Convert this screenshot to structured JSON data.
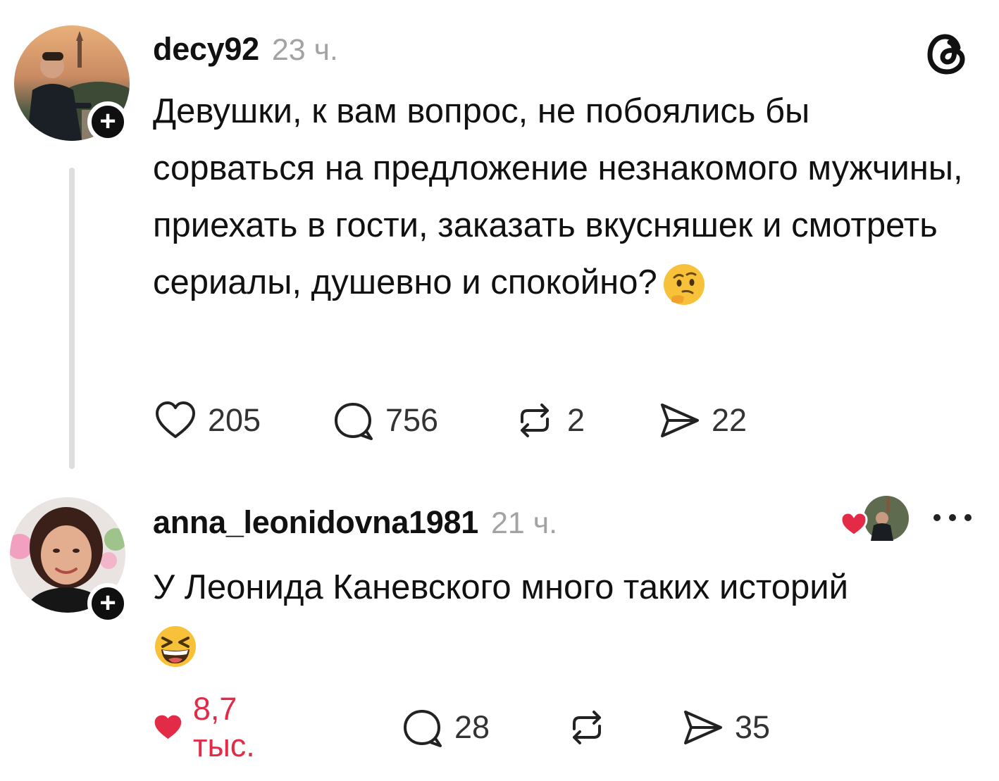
{
  "colors": {
    "like_red": "#e32a47",
    "muted": "#a3a3a3",
    "text": "#111111",
    "thread_line": "#dedede"
  },
  "posts": [
    {
      "username": "decy92",
      "time": "23 ч.",
      "text": "Девушки, к вам вопрос, не побоялись бы сорваться на предложение незнакомого мужчины, приехать в гости, заказать вкусняшек и смотреть сериалы, душевно и спокойно?",
      "emoji": "thinking-face-emoji",
      "follow_label": "+",
      "likes": "205",
      "comments": "756",
      "reposts": "2",
      "shares": "22",
      "liked": false
    },
    {
      "username": "anna_leonidovna1981",
      "time": "21 ч.",
      "text": "У Леонида Каневского много таких историй",
      "emoji": "grinning-squinting-face-emoji",
      "follow_label": "+",
      "likes": "8,7 тыс.",
      "comments": "28",
      "reposts": "",
      "shares": "35",
      "liked": true
    }
  ],
  "icons": [
    "threads-logo-icon",
    "heart-icon",
    "comment-bubble-icon",
    "repost-icon",
    "share-send-icon",
    "more-icon",
    "plus-icon"
  ]
}
